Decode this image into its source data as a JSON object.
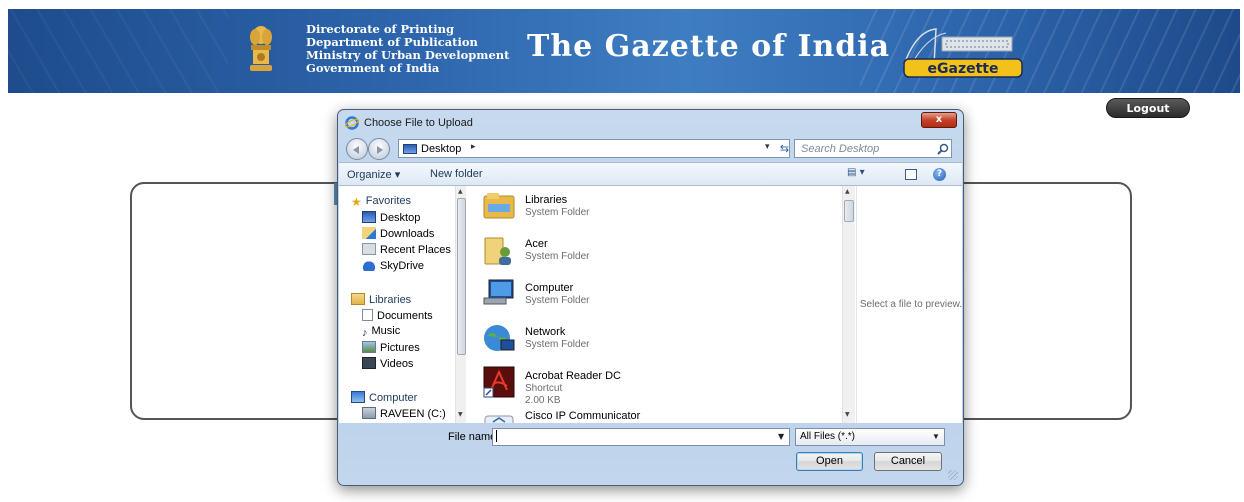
{
  "header": {
    "org_lines": [
      "Directorate of Printing",
      "Department of Publication",
      "Ministry of Urban Development",
      "Government of India"
    ],
    "title": "The Gazette of India",
    "logo_text": "eGazette",
    "emblem_icon": "india-emblem-icon"
  },
  "logout_label": "Logout",
  "dialog": {
    "title": "Choose File to Upload",
    "close_label": "x",
    "address": "Desktop",
    "search_placeholder": "Search Desktop",
    "toolbar": {
      "organize": "Organize ▾",
      "new_folder": "New folder"
    },
    "nav": {
      "favorites_label": "Favorites",
      "favorites": [
        "Desktop",
        "Downloads",
        "Recent Places",
        "SkyDrive"
      ],
      "libraries_label": "Libraries",
      "libraries": [
        "Documents",
        "Music",
        "Pictures",
        "Videos"
      ],
      "computer_label": "Computer",
      "drives": [
        "RAVEEN (C:)"
      ]
    },
    "files": [
      {
        "name": "Libraries",
        "type": "System Folder",
        "size": "",
        "icon": "libraries-folder-icon"
      },
      {
        "name": "Acer",
        "type": "System Folder",
        "size": "",
        "icon": "user-folder-icon"
      },
      {
        "name": "Computer",
        "type": "System Folder",
        "size": "",
        "icon": "computer-icon"
      },
      {
        "name": "Network",
        "type": "System Folder",
        "size": "",
        "icon": "network-icon"
      },
      {
        "name": "Acrobat Reader DC",
        "type": "Shortcut",
        "size": "2.00 KB",
        "icon": "acrobat-icon"
      },
      {
        "name": "Cisco IP Communicator",
        "type": "",
        "size": "",
        "icon": "cisco-icon"
      }
    ],
    "preview_text": "Select a file to preview.",
    "file_name_label": "File name:",
    "file_name_value": "",
    "filter_value": "All Files (*.*)",
    "open_label": "Open",
    "cancel_label": "Cancel"
  },
  "colors": {
    "banner": "#2c63aa",
    "dialog_frame": "#b6cde8",
    "close_red": "#c4422b"
  }
}
